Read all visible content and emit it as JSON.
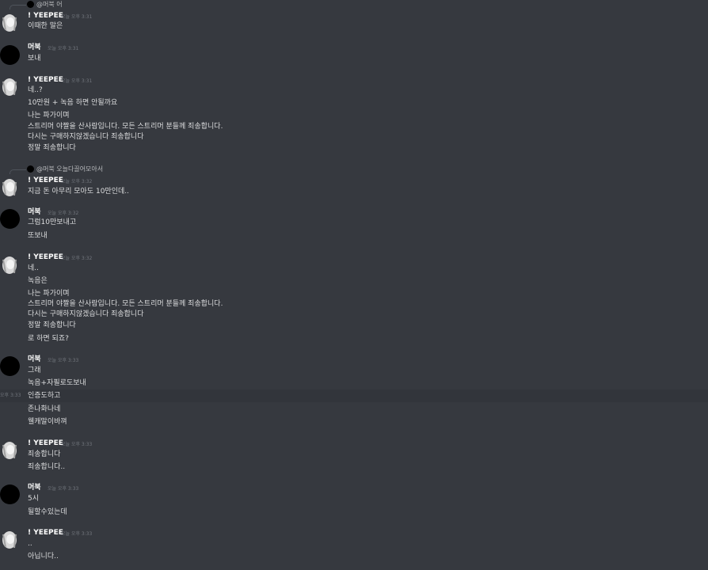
{
  "messages": [
    {
      "reply": "@머북 어",
      "author": "! YEEPEE",
      "time": "오늘 오후 3:31",
      "lines": [
        "이때한 말은"
      ]
    },
    {
      "author": "머북",
      "time": "오늘 오후 3:31",
      "lines": [
        "보내"
      ]
    },
    {
      "author": "! YEEPEE",
      "time": "오늘 오후 3:31",
      "lines": [
        "네..?",
        "10만원 + 녹음 하면 안될까요",
        "나는 파가이며",
        "스트리머 야짤을 산사람입니다. 모든 스트리머 분들께 죄송합니다.",
        "다시는 구매하지않겠습니다 죄송합니다",
        "정말 죄송합니다"
      ]
    },
    {
      "reply": "@머북 오늘다끌어모아서",
      "author": "! YEEPEE",
      "time": "오늘 오후 3:32",
      "lines": [
        "지금 돈 아무리 모아도 10만인데.."
      ]
    },
    {
      "author": "머북",
      "time": "오늘 오후 3:32",
      "lines": [
        "그럼10만보내고",
        "또보내"
      ]
    },
    {
      "author": "! YEEPEE",
      "time": "오늘 오후 3:32",
      "lines": [
        "네..",
        "녹음은",
        "나는 파가이며",
        "스트리머 야짤을 산사람입니다. 모든 스트리머 분들께 죄송합니다.",
        "다시는 구매하지않겠습니다 죄송합니다",
        "정말 죄송합니다",
        "로 하면 되죠?"
      ]
    },
    {
      "author": "머북",
      "time": "오늘 오후 3:33",
      "hover_time": "오후 3:33",
      "lines": [
        "그래",
        "녹음+자필로도보내",
        "인증도하고",
        "존나화나네",
        "웰캐말이바껴"
      ]
    },
    {
      "author": "! YEEPEE",
      "time": "오늘 오후 3:33",
      "lines": [
        "죄송합니다",
        "죄송합니다.."
      ]
    },
    {
      "author": "머북",
      "time": "오늘 오후 3:33",
      "lines": [
        "5시",
        "될할수있는데"
      ]
    },
    {
      "author": "! YEEPEE",
      "time": "오늘 오후 3:33",
      "lines": [
        "..",
        "아닙니다.."
      ]
    }
  ]
}
